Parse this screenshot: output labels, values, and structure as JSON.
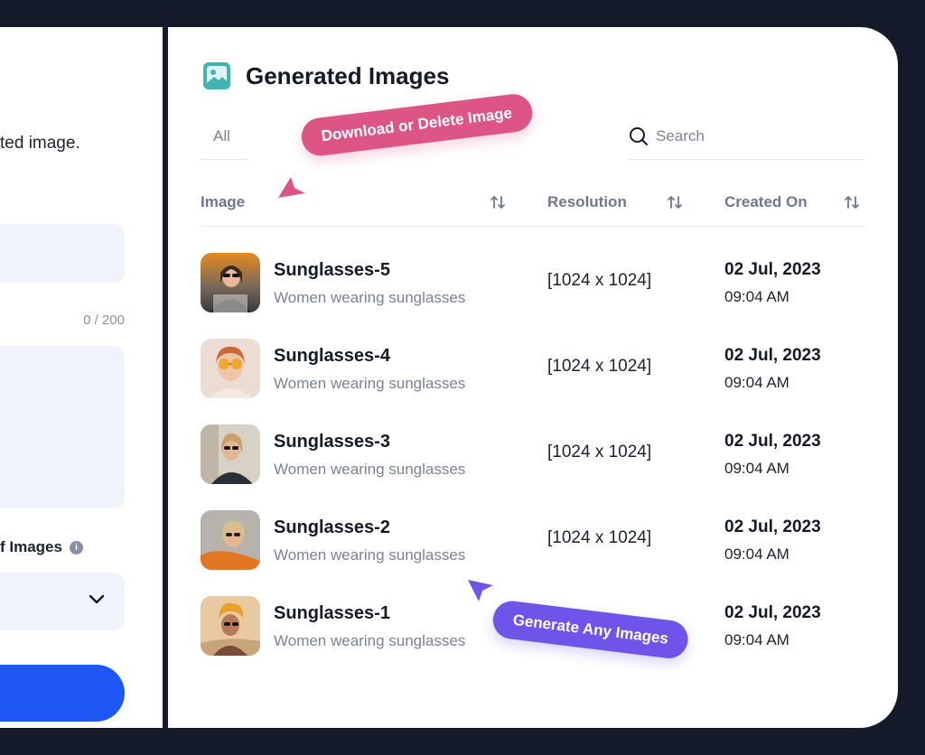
{
  "left_panel": {
    "description_text": "ted image.",
    "char_count": "0 / 200",
    "num_images_label": "f Images",
    "info_icon": "info-icon",
    "select_icon": "chevron-down-icon"
  },
  "panel": {
    "title": "Generated Images",
    "title_icon": "image-icon",
    "tab_all": "All",
    "search_placeholder": "Search"
  },
  "table": {
    "columns": [
      "Image",
      "Resolution",
      "Created On"
    ],
    "sort_icon": "sort-arrows-icon",
    "rows": [
      {
        "name": "Sunglasses-5",
        "description": "Women wearing sunglasses",
        "resolution": "[1024 x 1024]",
        "date": "02 Jul, 2023",
        "time": "09:04 AM"
      },
      {
        "name": "Sunglasses-4",
        "description": "Women wearing sunglasses",
        "resolution": "[1024 x 1024]",
        "date": "02 Jul, 2023",
        "time": "09:04 AM"
      },
      {
        "name": "Sunglasses-3",
        "description": "Women wearing sunglasses",
        "resolution": "[1024 x 1024]",
        "date": "02 Jul, 2023",
        "time": "09:04 AM"
      },
      {
        "name": "Sunglasses-2",
        "description": "Women wearing sunglasses",
        "resolution": "[1024 x 1024]",
        "date": "02 Jul, 2023",
        "time": "09:04 AM"
      },
      {
        "name": "Sunglasses-1",
        "description": "Women wearing sunglasses",
        "resolution": "",
        "date": "02 Jul, 2023",
        "time": "09:04 AM"
      }
    ]
  },
  "callouts": {
    "download_delete": "Download or Delete Image",
    "generate": "Generate Any Images"
  },
  "colors": {
    "frame": "#151a2b",
    "accent_teal": "#3fb4b0",
    "callout_pink": "#dd5585",
    "callout_purple": "#6f54ea",
    "primary_button": "#1f57f5",
    "field_bg": "#f1f3fc"
  }
}
